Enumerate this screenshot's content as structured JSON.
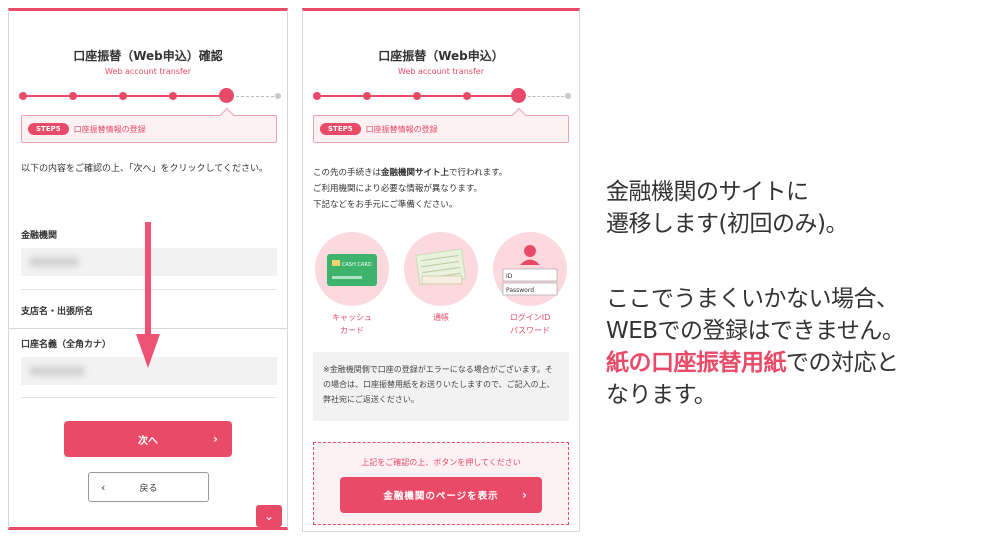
{
  "panel1": {
    "title": "口座振替（Web申込）確認",
    "subtitle": "Web account transfer",
    "step_pill": "STEP5",
    "step_text": "口座振替情報の登録",
    "instruction": "以下の内容をご確認の上、「次へ」をクリックしてください。",
    "fields": [
      {
        "label": "金融機関"
      },
      {
        "label": "支店名・出張所名"
      },
      {
        "label": "口座名義（全角カナ）"
      }
    ],
    "next_button": "次へ",
    "back_button": "戻る"
  },
  "panel2": {
    "title": "口座振替（Web申込）",
    "subtitle": "Web account transfer",
    "step_pill": "STEP5",
    "step_text": "口座振替情報の登録",
    "intro_line1_pre": "この先の手続きは",
    "intro_line1_bold": "金融機関サイト上",
    "intro_line1_post": "で行われます。",
    "intro_line2": "ご利用機関により必要な情報が異なります。",
    "intro_line3": "下記などをお手元にご準備ください。",
    "items": [
      {
        "line1": "キャッシュ",
        "line2": "カード",
        "card_text": "CASH CARD"
      },
      {
        "line1": "通帳",
        "line2": ""
      },
      {
        "line1": "ログインID",
        "line2": "パスワード",
        "id_label": "ID",
        "pw_label": "Password"
      }
    ],
    "note": "※金融機関側で口座の登録がエラーになる場合がございます。その場合は、口座振替用紙をお送りいたしますので、ご記入の上、弊社宛にご返送ください。",
    "confirm_text": "上記をご確認の上、ボタンを押してください",
    "bank_button": "金融機関のページを表示"
  },
  "explanation": {
    "line1": "金融機関のサイトに",
    "line2": "遷移します(初回のみ)。",
    "line3": "ここでうまくいかない場合、",
    "line4": "WEBでの登録はできません。",
    "line5_accent": "紙の口座振替用紙",
    "line5_rest": "での対応と",
    "line6": "なります。"
  },
  "colors": {
    "accent": "#e94a68",
    "light": "#fdf1f4"
  }
}
